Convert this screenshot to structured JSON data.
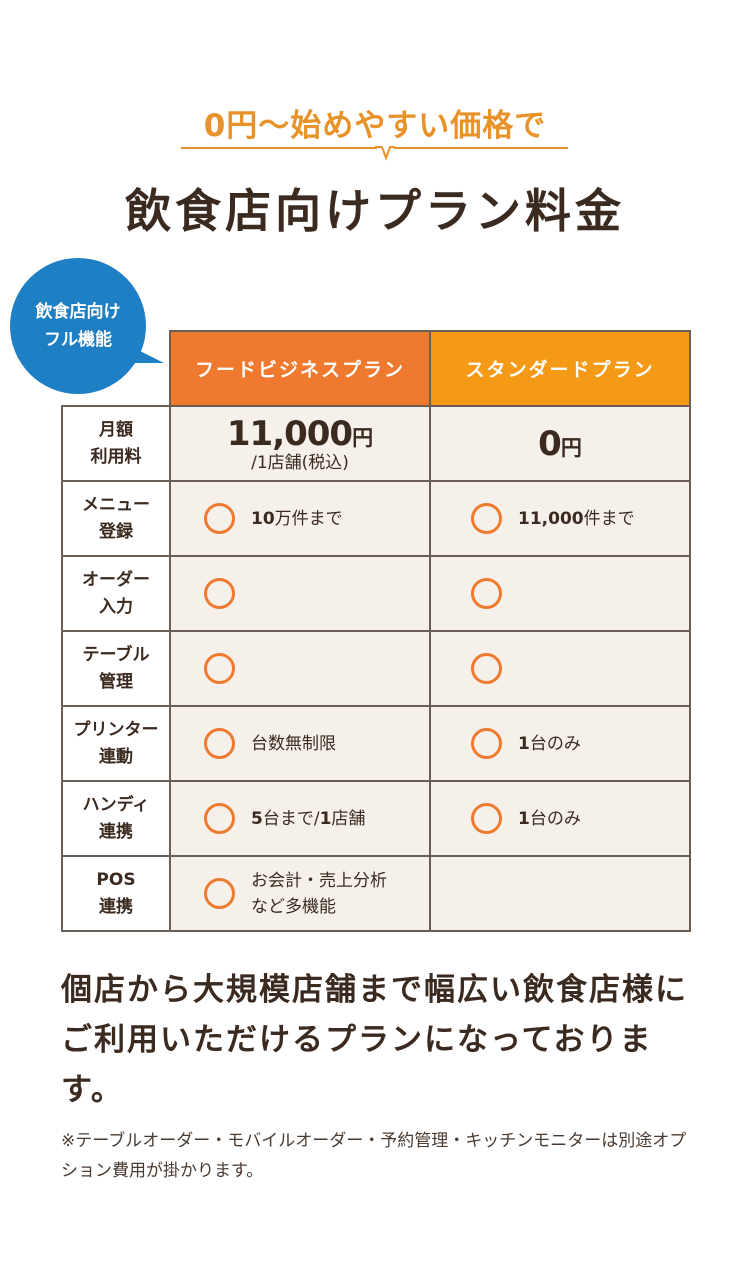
{
  "header": {
    "subtitle": "0円〜始めやすい価格で",
    "title": "飲食店向けプラン料金"
  },
  "badge": {
    "line1": "飲食店向け",
    "line2": "フル機能"
  },
  "plans": {
    "food": "フードビジネスプラン",
    "standard": "スタンダードプラン"
  },
  "rows": {
    "price": {
      "label1": "月額",
      "label2": "利用料",
      "food_amount": "11,000",
      "food_yen": "円",
      "food_sub": "/1店舗(税込)",
      "std_amount": "0",
      "std_yen": "円"
    },
    "menu": {
      "label1": "メニュー",
      "label2": "登録",
      "food_num": "10",
      "food_rest": "万件まで",
      "std_num": "11,000",
      "std_rest": "件まで"
    },
    "order": {
      "label1": "オーダー",
      "label2": "入力"
    },
    "table": {
      "label1": "テーブル",
      "label2": "管理"
    },
    "printer": {
      "label1": "プリンター",
      "label2": "連動",
      "food_text": "台数無制限",
      "std_num": "1",
      "std_rest": "台のみ"
    },
    "handy": {
      "label1": "ハンディ",
      "label2": "連携",
      "food_num1": "5",
      "food_mid": "台まで/",
      "food_num2": "1",
      "food_rest": "店舗",
      "std_num": "1",
      "std_rest": "台のみ"
    },
    "pos": {
      "label1": "POS",
      "label2": "連携",
      "food_line1": "お会計・売上分析",
      "food_line2": "など多機能"
    }
  },
  "description": "個店から大規模店舗まで幅広い飲食店様にご利用いただけるプランになっております。",
  "note": "※テーブルオーダー・モバイルオーダー・予約管理・キッチンモニターは別途オプション費用が掛かります。",
  "colors": {
    "accent_orange": "#ef7a2f",
    "standard_orange": "#f59a17",
    "subtitle_orange": "#e8922a",
    "badge_blue": "#1f7fc4",
    "text_brown": "#3b2a1f",
    "cell_bg": "#f5f1ea"
  }
}
